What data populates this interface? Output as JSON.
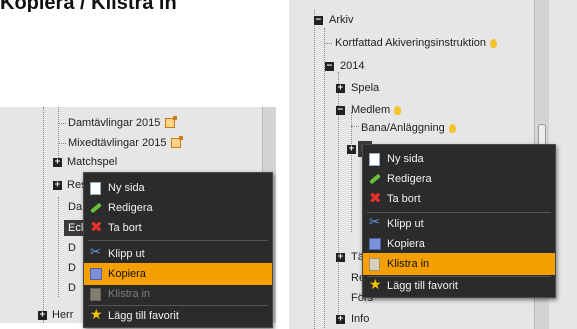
{
  "page_title": "Kopiera / Klistra in",
  "colors": {
    "highlight": "#f5a000",
    "menu_bg": "#2b2b2b",
    "tree_bg": "#e6e6e6"
  },
  "left": {
    "tree": [
      {
        "label": "Damtävlingar 2015",
        "icon": "external-link-icon"
      },
      {
        "label": "Mixedtävlingar 2015",
        "icon": "external-link-icon"
      },
      {
        "label": "Matchspel"
      },
      {
        "label": "Res"
      },
      {
        "label": "Da"
      },
      {
        "label": "Ecl"
      },
      {
        "label": "D"
      },
      {
        "label": "D"
      },
      {
        "label": "D"
      },
      {
        "label": "Herr"
      }
    ],
    "menu": [
      {
        "label": "Ny sida",
        "icon": "page-icon"
      },
      {
        "label": "Redigera",
        "icon": "pencil-icon"
      },
      {
        "label": "Ta bort",
        "icon": "delete-icon"
      },
      {
        "label": "Klipp ut",
        "icon": "scissors-icon"
      },
      {
        "label": "Kopiera",
        "icon": "copy-icon",
        "state": "highlighted"
      },
      {
        "label": "Klistra in",
        "icon": "paste-icon",
        "state": "disabled"
      },
      {
        "label": "Lägg till favorit",
        "icon": "star-icon"
      }
    ]
  },
  "right": {
    "tree": [
      {
        "label": "Arkiv"
      },
      {
        "label": "Kortfattad Akiveringsinstruktion",
        "icon": "lightbulb-icon"
      },
      {
        "label": "2014"
      },
      {
        "label": "Spela"
      },
      {
        "label": "Medlem",
        "icon": "lightbulb-icon"
      },
      {
        "label": "Bana/Anläggning",
        "icon": "lightbulb-icon"
      },
      {
        "label": "D"
      },
      {
        "label": "Täv"
      },
      {
        "label": "Res"
      },
      {
        "label": "Förs"
      },
      {
        "label": "Info"
      }
    ],
    "menu": [
      {
        "label": "Ny sida",
        "icon": "page-icon"
      },
      {
        "label": "Redigera",
        "icon": "pencil-icon"
      },
      {
        "label": "Ta bort",
        "icon": "delete-icon"
      },
      {
        "label": "Klipp ut",
        "icon": "scissors-icon"
      },
      {
        "label": "Kopiera",
        "icon": "copy-icon"
      },
      {
        "label": "Klistra in",
        "icon": "paste-icon",
        "state": "highlighted"
      },
      {
        "label": "Lägg till favorit",
        "icon": "star-icon"
      }
    ]
  }
}
